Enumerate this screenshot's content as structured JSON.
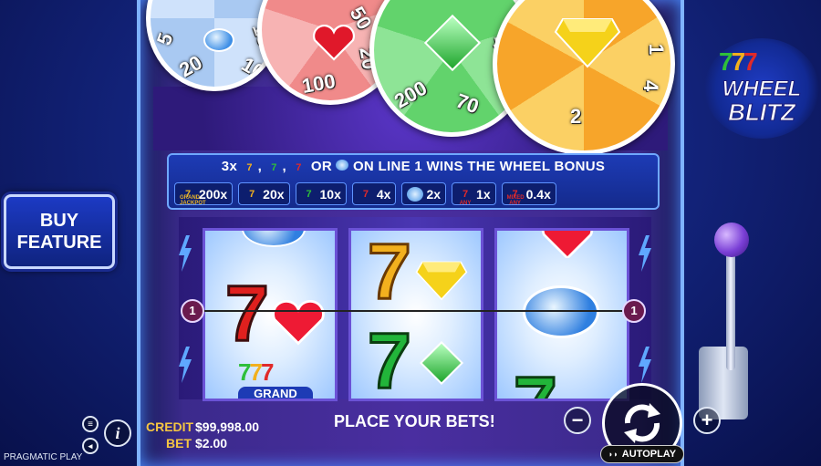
{
  "game": {
    "logo_777": "777",
    "logo_line1": "WHEEL",
    "logo_line2": "BLITZ"
  },
  "wheels": {
    "blue": [
      "5",
      "15",
      "20",
      "10"
    ],
    "red": [
      "50",
      "20",
      "100"
    ],
    "green": [
      "400",
      "70",
      "200"
    ],
    "orange": [
      "1",
      "4",
      "2"
    ]
  },
  "paytable": {
    "title_prefix": "3x",
    "title_mid1": ",",
    "title_mid2": ",",
    "title_or": "OR",
    "title_suffix": "ON LINE 1 WINS THE WHEEL BONUS",
    "items": [
      {
        "icon": "grand-jackpot-icon",
        "label": "GRAND JACKPOT",
        "value": "200x",
        "color": "#e8b52a"
      },
      {
        "icon": "gold-seven-icon",
        "label": "",
        "value": "20x",
        "color": "#f2b01e"
      },
      {
        "icon": "green-seven-icon",
        "label": "",
        "value": "10x",
        "color": "#2fbf3a"
      },
      {
        "icon": "red-seven-icon",
        "label": "",
        "value": "4x",
        "color": "#e02a2a"
      },
      {
        "icon": "blue-gem-icon",
        "label": "",
        "value": "2x",
        "color": "#4ea8ff"
      },
      {
        "icon": "any-seven-icon",
        "label": "ANY",
        "value": "1x",
        "color": "#e02a2a"
      },
      {
        "icon": "mixed-any-icon",
        "label": "MIXED ANY",
        "value": "0.4x",
        "color": "#e02a2a"
      }
    ]
  },
  "payline": {
    "number": "1"
  },
  "buy_feature": {
    "line1": "BUY",
    "line2": "FEATURE"
  },
  "reels": {
    "reel1_bottom_label": "GRAND"
  },
  "status": {
    "message": "PLACE YOUR BETS!",
    "credit_label": "CREDIT",
    "credit_value": "$99,998.00",
    "bet_label": "BET",
    "bet_value": "$2.00"
  },
  "controls": {
    "minus": "−",
    "plus": "+",
    "info": "i",
    "autoplay": "AUTOPLAY"
  },
  "provider": "PRAGMATIC PLAY",
  "colors": {
    "red": "#e02a2a",
    "green": "#2fbf3a",
    "gold": "#f2b01e",
    "blue": "#4ea8ff",
    "purple": "#6b52d6"
  }
}
